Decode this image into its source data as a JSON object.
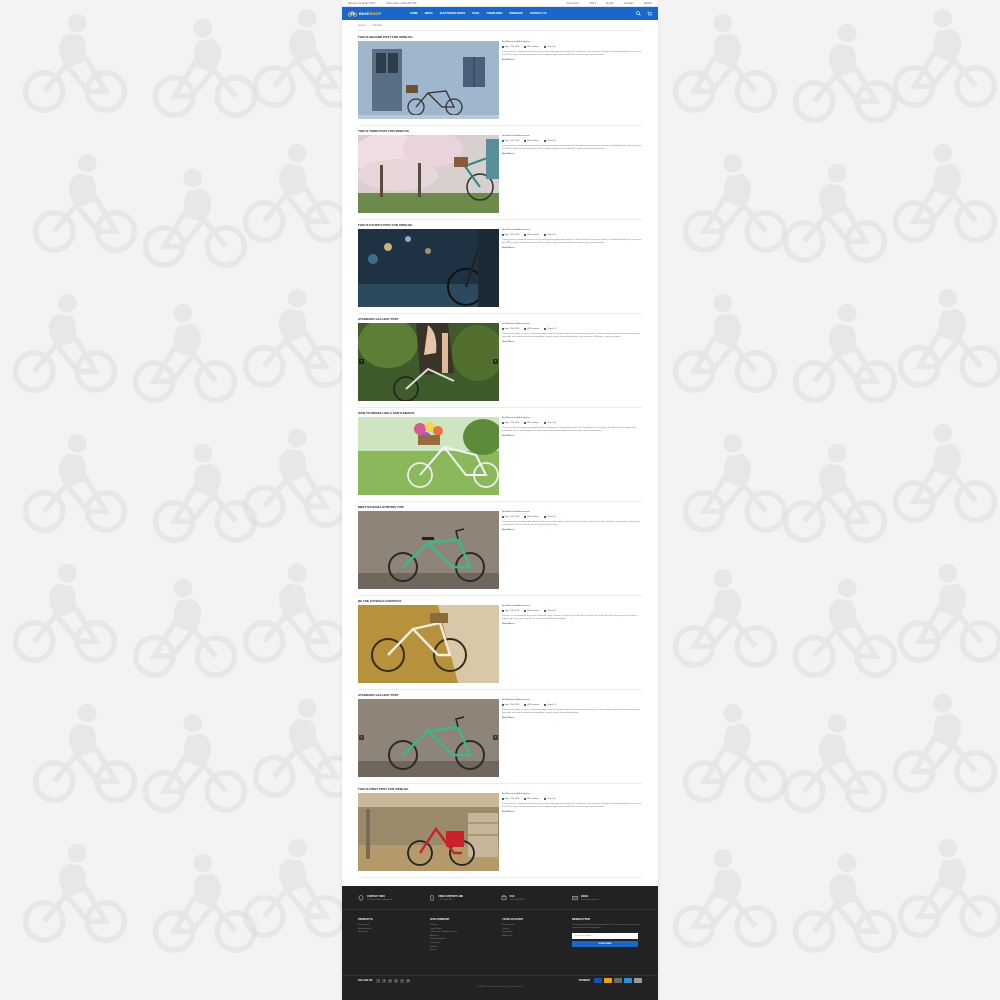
{
  "topbar": {
    "welcome": "Welcome To Studio Shop !",
    "phone": "Call us Now: +0123-456-789",
    "account": "My Account",
    "currency": "USD $",
    "language": "English",
    "compare": "Compare",
    "wishlist": "Wishlist"
  },
  "brand": {
    "name_prefix": "BIKE",
    "name_suffix": "SHOP"
  },
  "nav": [
    "HOME",
    "BIKES",
    "ELECTRONIC BIKES",
    "PAGE",
    "THEME BIKE",
    "WEBSHOP",
    "CONTACT US"
  ],
  "breadcrumb": "Home > ... > Parallax",
  "posts": [
    {
      "title": "This is Second Post For XIPBlog",
      "author": "By Webmaster Administrator",
      "date": "Aug 17th 2018",
      "category": "All Fashions",
      "views": "Views (2)",
      "excerpt": "Lorem ipsum is simply dummy text of the printing and typesetting industry. Lorem Ipsum has been the industry's standard dummy text ever since the 1500s, when an unknown printer took a galley of type and scrambled it to make a type specimen book.",
      "read_more": "Read More >",
      "image": "door-bike"
    },
    {
      "title": "This is Third Post For XIPBlog",
      "author": "By Webmaster Administrator",
      "date": "Aug 17th 2018",
      "category": "All Fashions",
      "views": "Views (2)",
      "excerpt": "Lorem ipsum is simply dummy text of the printing and typesetting industry. Lorem Ipsum has been the industry's standard dummy text ever since the 1500s, when an unknown printer took a galley of type and scrambled it to make a type specimen book.",
      "read_more": "Read More >",
      "image": "blossom-bike"
    },
    {
      "title": "This is Fourth Post For XIPBlog",
      "author": "By Webmaster Administrator",
      "date": "Aug 17th 2018",
      "category": "All Fashions",
      "views": "Views (2)",
      "excerpt": "Lorem ipsum is simply dummy text of the printing and typesetting industry. Lorem Ipsum has been the industry's standard dummy text ever since the 1500s, when an unknown printer took a galley of type and scrambled it to make a type specimen book.",
      "read_more": "Read More >",
      "image": "night-bike"
    },
    {
      "title": "Standard Gallery Post",
      "author": "By Webmaster Administrator",
      "date": "Aug 17th 2018",
      "category": "All Fashions",
      "views": "Views (2)",
      "excerpt": "Lorem ipsum dolor sit amet, consectetur adipisicing elit. Nostrum legimus fermentum iusto quam. In etiam eaque expedita, harum dicta pariatur reiciendis sunt sed praesentium voluptatem corporis rerum eligendi quibusdam nulla voluptate. Molestias, corporis maxime.",
      "read_more": "Read More >",
      "image": "rider-bike",
      "gallery": true
    },
    {
      "title": "How To Dress Like A Gentleman's",
      "author": "By Webmaster Administrator",
      "date": "Aug 17th 2018",
      "category": "All Fashions",
      "views": "Views (2)",
      "excerpt": "The first of the three-piece ensemble with the Gentleman's Instruments in the lead. If gentleman is the king of the ball, the true dandy, in the gentleman sense of the word, is not able to go a day without being seen in the best shoes and fashions.",
      "read_more": "Read More >",
      "image": "flower-bike"
    },
    {
      "title": "Meet Natasha Stinting Tum",
      "author": "By Webmaster Administrator",
      "date": "Aug 17th 2018",
      "category": "All Fashions",
      "views": "Views (2)",
      "excerpt": "Transform your everyday style with the help of our expert stylists. Get the looks you love. Discover the latest trends in street style, accessories, and timeless classics chosen for you by our fashion team.",
      "read_more": "Read More >",
      "image": "green-bike"
    },
    {
      "title": "Be The Catwalk Everyday",
      "author": "By Webmaster Administrator",
      "date": "Aug 17th 2018",
      "category": "All Fashions",
      "views": "Views (2)",
      "excerpt": "Fashion is not something that exists in dresses only. Fashion is in the sky, in the street, fashion has to do with ideas, the way we live, what is happening. Dress up every day as if you were walking the catwalk.",
      "read_more": "Read More >",
      "image": "yellow-bike"
    },
    {
      "title": "Standard Gallery Post",
      "author": "By Webmaster Administrator",
      "date": "Aug 17th 2018",
      "category": "All Fashions",
      "views": "Views (2)",
      "excerpt": "Lorem ipsum dolor sit amet, consectetur adipisicing elit. Nostrum legimus fermentum iusto quam. In etiam eaque expedita, harum dicta pariatur reiciendis sunt sed praesentium voluptatem corporis rerum eligendi quibusdam.",
      "read_more": "Read More >",
      "image": "green-bike-2",
      "gallery": true
    },
    {
      "title": "This is First Post For XIPBlog",
      "author": "By Webmaster Administrator",
      "date": "Aug 17th 2018",
      "category": "All Fashions",
      "views": "Views (2)",
      "excerpt": "Lorem ipsum is simply dummy text of the printing and typesetting industry. Lorem Ipsum has been the industry's standard dummy text ever since the 1500s, when an unknown printer took a galley of type and scrambled it to make a type specimen book.",
      "read_more": "Read More >",
      "image": "red-bike"
    }
  ],
  "footer": {
    "contacts": [
      {
        "icon": "map-pin-icon",
        "title": "CONTACT INFO",
        "value": "123 Main Street, Anytown"
      },
      {
        "icon": "phone-icon",
        "title": "FREE SUPPORT LINE",
        "value": "+123-456-789"
      },
      {
        "icon": "fax-icon",
        "title": "FAX",
        "value": "+012-345-678"
      },
      {
        "icon": "mail-icon",
        "title": "EMAIL",
        "value": "demo@email.com"
      }
    ],
    "columns": [
      {
        "title": "PRODUCTS",
        "links": [
          "Prices drop",
          "New products",
          "Best sales"
        ]
      },
      {
        "title": "OUR COMPANY",
        "links": [
          "Delivery",
          "Legal Notice",
          "Terms and conditions of use",
          "About us",
          "Secure payment",
          "Contact us",
          "Sitemap",
          "Stores"
        ]
      },
      {
        "title": "YOUR ACCOUNT",
        "links": [
          "Personal info",
          "Orders",
          "Credit slips",
          "Addresses"
        ]
      }
    ],
    "newsletter": {
      "title": "NEWSLETTER",
      "text": "You may unsubscribe at any moment. For that purpose, please find our contact info in the legal notice.",
      "placeholder": "Your email address",
      "button": "SUBSCRIBE"
    },
    "follow_label": "FOLLOW US",
    "social": [
      "f",
      "t",
      "g",
      "p",
      "v",
      "in"
    ],
    "payment_label": "PAYMENT",
    "payment_colors": [
      "#1a4fb5",
      "#e8a01a",
      "#6b6b6b",
      "#2b8fd9",
      "#9a9a9a"
    ],
    "copyright": "© 2018 - Ecommerce software by PrestaShop™"
  },
  "colors": {
    "brand": "#1a66c9",
    "footer": "#222222"
  }
}
